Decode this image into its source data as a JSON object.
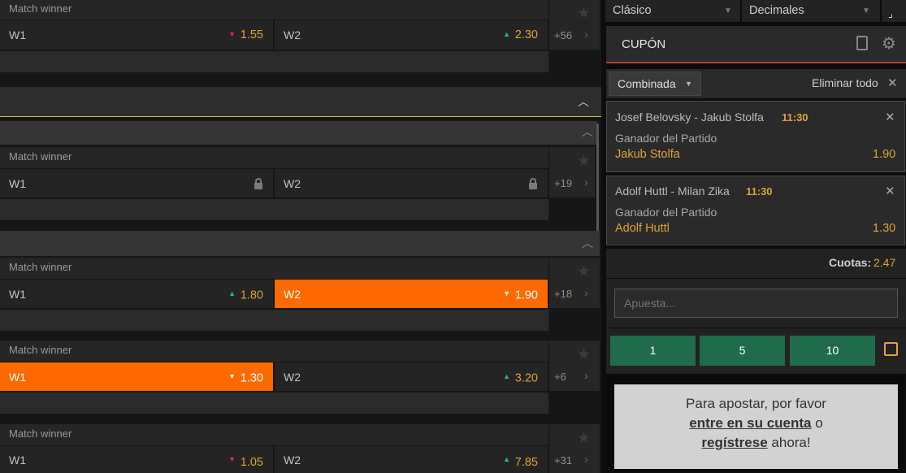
{
  "markets": [
    {
      "title": "Match winner",
      "w1": {
        "label": "W1",
        "value": "1.55",
        "trend": "down",
        "selected": false
      },
      "w2": {
        "label": "W2",
        "value": "2.30",
        "trend": "up",
        "selected": false
      },
      "more": "+56"
    },
    {
      "title": "Match winner",
      "w1": {
        "label": "W1",
        "value": "",
        "trend": "",
        "locked": true
      },
      "w2": {
        "label": "W2",
        "value": "",
        "trend": "",
        "locked": true
      },
      "more": "+19"
    },
    {
      "title": "Match winner",
      "w1": {
        "label": "W1",
        "value": "1.80",
        "trend": "up",
        "selected": false
      },
      "w2": {
        "label": "W2",
        "value": "1.90",
        "trend": "down",
        "selected": true
      },
      "more": "+18"
    },
    {
      "title": "Match winner",
      "w1": {
        "label": "W1",
        "value": "1.30",
        "trend": "down",
        "selected": true
      },
      "w2": {
        "label": "W2",
        "value": "3.20",
        "trend": "up",
        "selected": false
      },
      "more": "+6"
    },
    {
      "title": "Match winner",
      "w1": {
        "label": "W1",
        "value": "1.05",
        "trend": "down",
        "selected": false
      },
      "w2": {
        "label": "W2",
        "value": "7.85",
        "trend": "up",
        "selected": false
      },
      "more": "+31"
    }
  ],
  "icons": {
    "star": "star-icon",
    "chevron": "chevron-right-icon",
    "collapse": "chevron-up-icon",
    "lock": "lock-icon"
  },
  "betslip": {
    "view_select": "Clásico",
    "odds_format_select": "Decimales",
    "title": "CUPÓN",
    "bet_type": "Combinada",
    "remove_all": "Eliminar todo",
    "selections": [
      {
        "event": "Josef Belovsky - Jakub Stolfa",
        "time": "11:30",
        "market": "Ganador del Partido",
        "pick": "Jakub Stolfa",
        "odds": "1.90"
      },
      {
        "event": "Adolf Huttl - Milan Zika",
        "time": "11:30",
        "market": "Ganador del Partido",
        "pick": "Adolf Huttl",
        "odds": "1.30"
      }
    ],
    "total_odds_label": "Cuotas:",
    "total_odds_value": "2.47",
    "stake_placeholder": "Apuesta...",
    "quick_stakes": [
      "1",
      "5",
      "10"
    ],
    "login_msg_1": "Para apostar, por favor",
    "login_link": "entre en su cuenta",
    "login_or": "o",
    "register_link": "regístrese",
    "login_msg_2": "ahora!"
  },
  "colors": {
    "accent": "#ff6a00",
    "odds": "#e0a239",
    "up": "#25c05a",
    "down": "#e02d3c",
    "stake_button": "#1f6b4c",
    "section_line": "#d4c14a"
  }
}
